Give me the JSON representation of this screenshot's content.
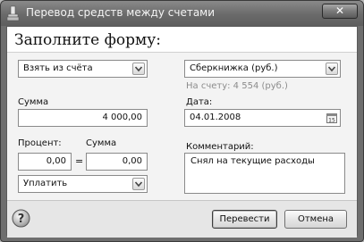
{
  "window": {
    "title": "Перевод средств между счетами",
    "close_glyph": "✕"
  },
  "form": {
    "heading": "Заполните форму:"
  },
  "source": {
    "selected": "Взять из счёта"
  },
  "target": {
    "selected": "Сберкнижка (руб.)",
    "balance_text": "На счету: 4 554 (руб.)"
  },
  "amount": {
    "label": "Сумма",
    "value": "4 000,00"
  },
  "date": {
    "label": "Дата:",
    "value": "04.01.2008"
  },
  "percent": {
    "label": "Процент:",
    "value": "0,00",
    "equals": "="
  },
  "fee": {
    "label": "Сумма",
    "value": "0,00"
  },
  "fee_mode": {
    "selected": "Уплатить"
  },
  "comment": {
    "label": "Комментарий:",
    "value": "Снял на текущие расходы"
  },
  "buttons": {
    "transfer": "Перевести",
    "cancel": "Отмена"
  },
  "icons": {
    "app": "app-icon",
    "help": "help-icon",
    "calendar": "calendar-icon",
    "dropdown": "chevron-down-icon"
  }
}
